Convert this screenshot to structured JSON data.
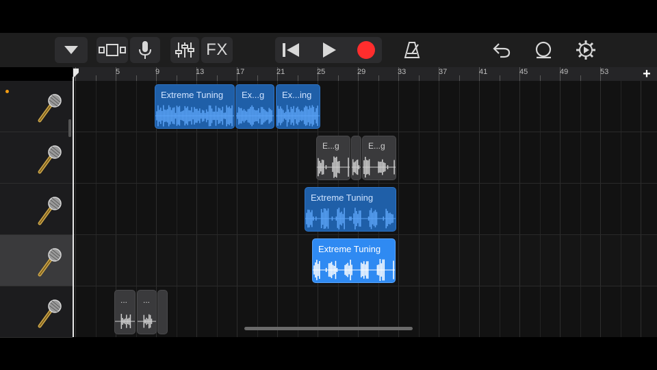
{
  "toolbar": {
    "fx_label": "FX",
    "icons": [
      "dropdown-icon",
      "tracks-view-icon",
      "microphone-icon",
      "mixer-icon",
      "rewind-icon",
      "play-icon",
      "record-icon",
      "metronome-icon",
      "undo-icon",
      "loop-icon",
      "settings-icon"
    ],
    "record_color": "#ff2d2d"
  },
  "ruler": {
    "labels": [
      "5",
      "9",
      "13",
      "17",
      "21",
      "25",
      "29",
      "33",
      "37",
      "41",
      "45",
      "49",
      "53"
    ],
    "add_label": "+"
  },
  "tracks": [
    {
      "instrument": "microphone",
      "selected": false,
      "has_dot": true
    },
    {
      "instrument": "microphone",
      "selected": false,
      "has_dot": false
    },
    {
      "instrument": "microphone",
      "selected": false,
      "has_dot": false
    },
    {
      "instrument": "microphone",
      "selected": true,
      "has_dot": false
    },
    {
      "instrument": "microphone",
      "selected": false,
      "has_dot": false
    }
  ],
  "regions": [
    {
      "track": 0,
      "label": "Extreme Tuning",
      "style": "blue"
    },
    {
      "track": 0,
      "label": "Ex...g",
      "style": "blue"
    },
    {
      "track": 0,
      "label": "Ex...ing",
      "style": "blue"
    },
    {
      "track": 1,
      "label": "E...g",
      "style": "gray"
    },
    {
      "track": 1,
      "label": "",
      "style": "gray"
    },
    {
      "track": 1,
      "label": "E...g",
      "style": "gray"
    },
    {
      "track": 2,
      "label": "Extreme Tuning",
      "style": "blue"
    },
    {
      "track": 3,
      "label": "Extreme Tuning",
      "style": "blue-sel"
    },
    {
      "track": 4,
      "label": "...",
      "style": "gray"
    },
    {
      "track": 4,
      "label": "...",
      "style": "gray"
    },
    {
      "track": 4,
      "label": "",
      "style": "gray"
    }
  ],
  "colors": {
    "accent": "#2f8af2",
    "region_blue": "#1f5fa8",
    "region_gray": "#3a3a3c",
    "indicator": "#f39c12"
  }
}
